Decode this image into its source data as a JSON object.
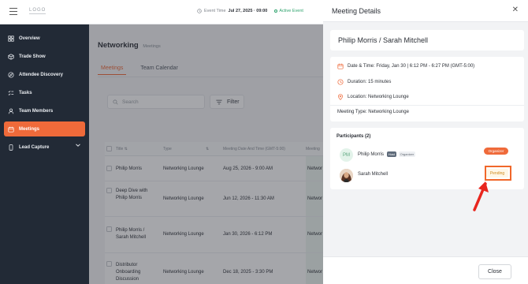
{
  "topbar": {
    "logo": "LOGO",
    "event_time_label": "Event Time",
    "event_time_value": "Jul 27, 2025 · 09:00",
    "active_event": "Active Event"
  },
  "sidebar": {
    "items": [
      {
        "label": "Overview",
        "icon": "grid-icon"
      },
      {
        "label": "Trade Show",
        "icon": "cube-icon"
      },
      {
        "label": "Attendee Discovery",
        "icon": "compass-icon"
      },
      {
        "label": "Tasks",
        "icon": "checklist-icon"
      },
      {
        "label": "Team Members",
        "icon": "user-icon"
      },
      {
        "label": "Meetings",
        "icon": "calendar-icon",
        "active": true
      },
      {
        "label": "Lead Capture",
        "icon": "phone-icon",
        "has_chevron": true
      }
    ]
  },
  "main": {
    "title": "Networking",
    "breadcrumb": "Meetings",
    "tabs": [
      "Meetings",
      "Team Calendar"
    ],
    "search_placeholder": "Search",
    "filter_label": "Filter",
    "table": {
      "headers": [
        "Title",
        "Type",
        "Meeting Date And Time (GMT-5:00)",
        "Meeting"
      ],
      "rows": [
        {
          "title": "Philip Morris",
          "type": "Networking Lounge",
          "datetime": "Aug 25, 2026 - 9:00 AM",
          "location": "Networ"
        },
        {
          "title": "Deep Dive with Philip Morris",
          "type": "Networking Lounge",
          "datetime": "Jun 12, 2026 - 11:30 AM",
          "location": "Networ"
        },
        {
          "title": "Philip Morris / Sarah Mitchell",
          "type": "Networking Lounge",
          "datetime": "Jan 30, 2026 - 6:12 PM",
          "location": "Networ"
        },
        {
          "title": "Distributor Onboarding Discussion",
          "type": "Networking Lounge",
          "datetime": "Dec 18, 2025 - 3:30 PM",
          "location": "Networ"
        }
      ]
    }
  },
  "modal": {
    "title": "Meeting Details",
    "meeting_name": "Philip Morris / Sarah Mitchell",
    "date_time": "Date & Time: Friday, Jan 30 | 6:12 PM - 6:27 PM (GMT-5:00)",
    "duration": "Duration: 15 minutes",
    "location": "Location: Networking Lounge",
    "meeting_type": "Meeting Type: Networking Lounge",
    "participants_title": "Participants (2)",
    "participants": [
      {
        "initials": "PM",
        "name": "Philip Morris",
        "tag_host": "Host",
        "tag_org": "Organizer",
        "badge": "Organizer"
      },
      {
        "name": "Sarah Mitchell",
        "badge": "Pending"
      }
    ],
    "close_label": "Close"
  },
  "colors": {
    "accent": "#ef6a3a",
    "sidebar_bg": "#222a36",
    "active_green": "#2ea36d",
    "pending": "#d08a1a",
    "annotation_red": "#f0672a"
  }
}
